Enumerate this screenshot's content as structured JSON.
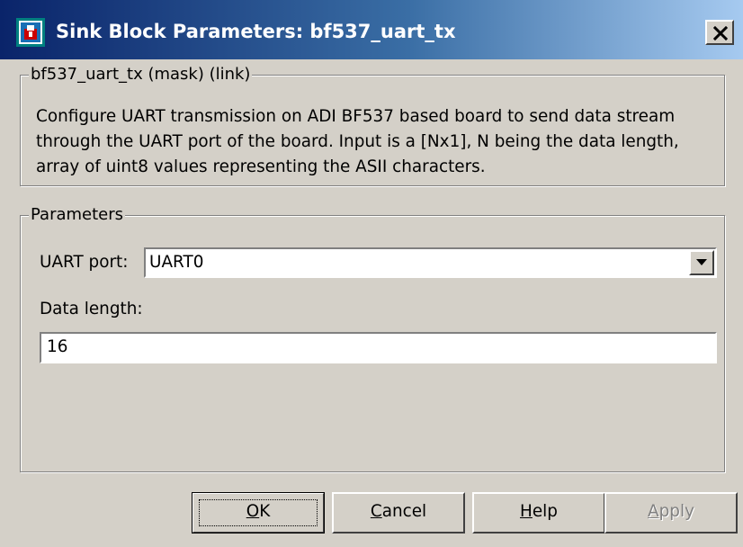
{
  "window": {
    "title": "Sink Block Parameters: bf537_uart_tx",
    "close_symbol": "✕"
  },
  "mask_group": {
    "legend": "bf537_uart_tx (mask) (link)",
    "description": "Configure UART transmission on ADI BF537 based board to send data stream through the UART port of the board.  Input is a [Nx1], N being the data length, array of uint8 values representing the ASII characters."
  },
  "params_group": {
    "legend": "Parameters",
    "uart_port": {
      "label": "UART port:",
      "value": "UART0"
    },
    "data_length": {
      "label": "Data length:",
      "value": "16"
    }
  },
  "buttons": {
    "ok": {
      "mnemonic": "O",
      "rest": "K"
    },
    "cancel": {
      "mnemonic": "C",
      "rest": "ancel"
    },
    "help": {
      "mnemonic": "H",
      "rest": "elp"
    },
    "apply": {
      "mnemonic": "A",
      "rest": "pply",
      "enabled": false
    }
  },
  "icons": {
    "app": "simulink-block-icon",
    "close": "close-icon",
    "dropdown": "chevron-down-icon"
  },
  "colors": {
    "title_bar_start": "#0a246a",
    "title_bar_end": "#a6caf0",
    "window_bg": "#d4d0c8"
  }
}
